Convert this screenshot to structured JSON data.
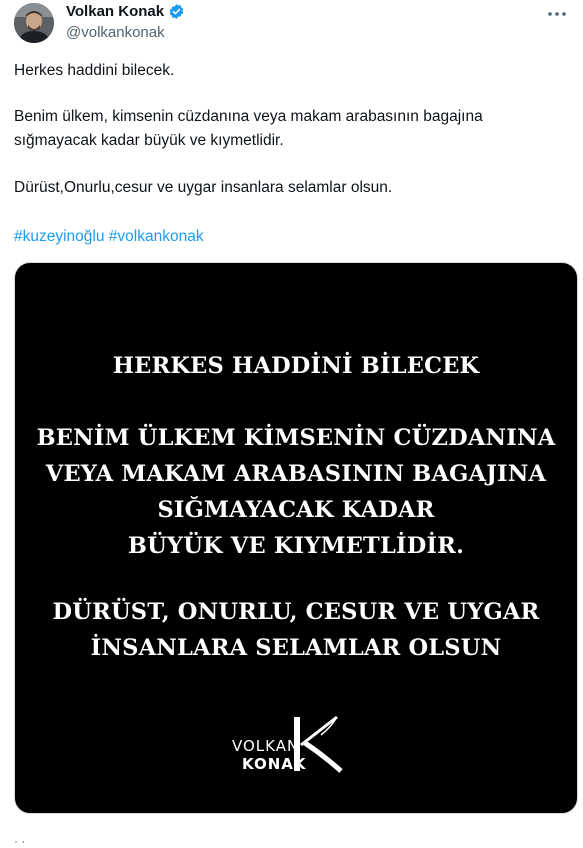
{
  "author": {
    "display_name": "Volkan Konak",
    "handle": "@volkankonak",
    "verified": true
  },
  "tweet": {
    "paragraphs": [
      "Herkes haddini bilecek.",
      "Benim ülkem, kimsenin cüzdanına veya makam arabasının bagajına",
      "sığmayacak kadar büyük ve kıymetlidir.",
      "Dürüst,Onurlu,cesur ve uygar insanlara selamlar olsun."
    ],
    "hashtags": [
      "#kuzeyinoğlu",
      "#volkankonak"
    ]
  },
  "media": {
    "lines": [
      "HERKES HADDİNİ BİLECEK",
      "BENİM ÜLKEM KİMSENİN CÜZDANINA",
      "VEYA MAKAM ARABASININ BAGAJINA",
      "SIĞMAYACAK KADAR",
      "BÜYÜK VE KIYMETLİDİR.",
      "DÜRÜST, ONURLU, CESUR VE UYGAR",
      "İNSANLARA SELAMLAR OLSUN"
    ],
    "logo": {
      "first": "VOLKAN",
      "last": "KONAK",
      "mark": "K"
    }
  },
  "footer": {
    "partial": "· ·"
  },
  "colors": {
    "accent": "#1d9bf0",
    "text": "#0f1419",
    "muted": "#536471",
    "media_bg": "#000000"
  }
}
